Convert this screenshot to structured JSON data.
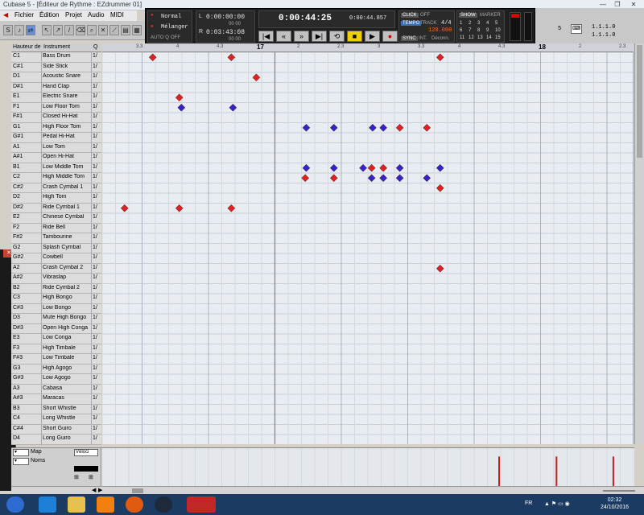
{
  "window": {
    "title": "Cubase 5 - [Éditeur de Rythme : EZdrummer 01]"
  },
  "menu": {
    "items": [
      "Fichier",
      "Édition",
      "Projet",
      "Audio",
      "MIDI"
    ]
  },
  "transport": {
    "mode1": "Normal",
    "mode2": "Mélanger",
    "auto_q": "AUTO Q",
    "auto_q_state": "OFF",
    "left_locator": "0:00:00:00",
    "right_locator": "0:03:43:08",
    "sub1": "00 00",
    "sub2": "00 00",
    "primary_time": "0:00:44:25",
    "secondary_time": "0:00:44.857",
    "click_label": "CLICK",
    "click_state": "OFF",
    "tempo_label": "TEMPO",
    "track_label": "TRACK",
    "signature": "4/4",
    "tempo_value": "120.000",
    "sync_label": "SYNC",
    "int_label": "INT.",
    "deconn_label": "Déconn.",
    "show_label": "SHOW",
    "marker_label": "MARKER",
    "marker_numbers": [
      "1",
      "2",
      "3",
      "4",
      "5",
      "6",
      "7",
      "8",
      "9",
      "10",
      "11",
      "12",
      "13",
      "14",
      "15"
    ]
  },
  "right_panel": {
    "v1": "1.1.1.0",
    "v2": "1.1.1.0",
    "v3": "5"
  },
  "list_header": {
    "pitch": "Hauteur de",
    "instrument": "Instrument",
    "q": "Q"
  },
  "instruments": [
    {
      "pitch": "C1",
      "name": "Bass Drum",
      "q": "1/"
    },
    {
      "pitch": "C#1",
      "name": "Side Stick",
      "q": "1/"
    },
    {
      "pitch": "D1",
      "name": "Acoustic Snare",
      "q": "1/"
    },
    {
      "pitch": "D#1",
      "name": "Hand Clap",
      "q": "1/"
    },
    {
      "pitch": "E1",
      "name": "Electric Snare",
      "q": "1/"
    },
    {
      "pitch": "F1",
      "name": "Low Floor Tom",
      "q": "1/"
    },
    {
      "pitch": "F#1",
      "name": "Closed Hi-Hat",
      "q": "1/"
    },
    {
      "pitch": "G1",
      "name": "High Floor Tom",
      "q": "1/"
    },
    {
      "pitch": "G#1",
      "name": "Pedal Hi-Hat",
      "q": "1/"
    },
    {
      "pitch": "A1",
      "name": "Low Tom",
      "q": "1/"
    },
    {
      "pitch": "A#1",
      "name": "Open Hi-Hat",
      "q": "1/"
    },
    {
      "pitch": "B1",
      "name": "Low Middle Tom",
      "q": "1/"
    },
    {
      "pitch": "C2",
      "name": "High Middle Tom",
      "q": "1/"
    },
    {
      "pitch": "C#2",
      "name": "Crash Cymbal 1",
      "q": "1/"
    },
    {
      "pitch": "D2",
      "name": "High Tom",
      "q": "1/"
    },
    {
      "pitch": "D#2",
      "name": "Ride Cymbal 1",
      "q": "1/"
    },
    {
      "pitch": "E2",
      "name": "Chinese Cymbal",
      "q": "1/"
    },
    {
      "pitch": "F2",
      "name": "Ride Bell",
      "q": "1/"
    },
    {
      "pitch": "F#2",
      "name": "Tambourine",
      "q": "1/"
    },
    {
      "pitch": "G2",
      "name": "Splash Cymbal",
      "q": "1/"
    },
    {
      "pitch": "G#2",
      "name": "Cowbell",
      "q": "1/"
    },
    {
      "pitch": "A2",
      "name": "Crash Cymbal 2",
      "q": "1/"
    },
    {
      "pitch": "A#2",
      "name": "Vibraslap",
      "q": "1/"
    },
    {
      "pitch": "B2",
      "name": "Ride Cymbal 2",
      "q": "1/"
    },
    {
      "pitch": "C3",
      "name": "High Bongo",
      "q": "1/"
    },
    {
      "pitch": "C#3",
      "name": "Low Bongo",
      "q": "1/"
    },
    {
      "pitch": "D3",
      "name": "Mute High Bongo",
      "q": "1/"
    },
    {
      "pitch": "D#3",
      "name": "Open High Conga",
      "q": "1/"
    },
    {
      "pitch": "E3",
      "name": "Low Conga",
      "q": "1/"
    },
    {
      "pitch": "F3",
      "name": "High Timbale",
      "q": "1/"
    },
    {
      "pitch": "F#3",
      "name": "Low Timbale",
      "q": "1/"
    },
    {
      "pitch": "G3",
      "name": "High Agogo",
      "q": "1/"
    },
    {
      "pitch": "G#3",
      "name": "Low Agogo",
      "q": "1/"
    },
    {
      "pitch": "A3",
      "name": "Cabasa",
      "q": "1/"
    },
    {
      "pitch": "A#3",
      "name": "Maracas",
      "q": "1/"
    },
    {
      "pitch": "B3",
      "name": "Short Whistle",
      "q": "1/"
    },
    {
      "pitch": "C4",
      "name": "Long Whistle",
      "q": "1/"
    },
    {
      "pitch": "C#4",
      "name": "Short Guiro",
      "q": "1/"
    },
    {
      "pitch": "D4",
      "name": "Long Guiro",
      "q": "1/"
    }
  ],
  "ruler": {
    "labels": [
      "3.3",
      "4",
      "4.3",
      "17",
      "2",
      "2.3",
      "3",
      "3.3",
      "4",
      "4.3",
      "18",
      "2",
      "2.3"
    ],
    "bar_labels": [
      "17",
      "18"
    ]
  },
  "notes_description": "drum hits: row index (from instrument list) and beat position (0..1 across visible range), color red or blue",
  "drum_hits": [
    {
      "row": 0,
      "pos": 0.095,
      "color": "red"
    },
    {
      "row": 0,
      "pos": 0.243,
      "color": "red"
    },
    {
      "row": 0,
      "pos": 0.636,
      "color": "red"
    },
    {
      "row": 2,
      "pos": 0.29,
      "color": "red"
    },
    {
      "row": 4,
      "pos": 0.145,
      "color": "red"
    },
    {
      "row": 5,
      "pos": 0.149,
      "color": "blue"
    },
    {
      "row": 5,
      "pos": 0.246,
      "color": "blue"
    },
    {
      "row": 7,
      "pos": 0.384,
      "color": "blue"
    },
    {
      "row": 7,
      "pos": 0.436,
      "color": "blue"
    },
    {
      "row": 7,
      "pos": 0.509,
      "color": "blue"
    },
    {
      "row": 7,
      "pos": 0.529,
      "color": "blue"
    },
    {
      "row": 7,
      "pos": 0.56,
      "color": "red"
    },
    {
      "row": 7,
      "pos": 0.611,
      "color": "red"
    },
    {
      "row": 11,
      "pos": 0.384,
      "color": "blue"
    },
    {
      "row": 11,
      "pos": 0.436,
      "color": "blue"
    },
    {
      "row": 11,
      "pos": 0.491,
      "color": "blue"
    },
    {
      "row": 11,
      "pos": 0.507,
      "color": "red"
    },
    {
      "row": 11,
      "pos": 0.529,
      "color": "red"
    },
    {
      "row": 11,
      "pos": 0.56,
      "color": "blue"
    },
    {
      "row": 11,
      "pos": 0.636,
      "color": "blue"
    },
    {
      "row": 12,
      "pos": 0.382,
      "color": "red"
    },
    {
      "row": 12,
      "pos": 0.436,
      "color": "red"
    },
    {
      "row": 12,
      "pos": 0.507,
      "color": "blue"
    },
    {
      "row": 12,
      "pos": 0.529,
      "color": "blue"
    },
    {
      "row": 12,
      "pos": 0.56,
      "color": "blue"
    },
    {
      "row": 12,
      "pos": 0.611,
      "color": "blue"
    },
    {
      "row": 13,
      "pos": 0.636,
      "color": "red"
    },
    {
      "row": 15,
      "pos": 0.042,
      "color": "red"
    },
    {
      "row": 15,
      "pos": 0.145,
      "color": "red"
    },
    {
      "row": 15,
      "pos": 0.243,
      "color": "red"
    },
    {
      "row": 21,
      "pos": 0.636,
      "color": "red"
    }
  ],
  "velocity_lane": {
    "map_label": "Map",
    "velocity_label": "Véloci",
    "names_label": "Noms",
    "bars": [
      0.78,
      0.78,
      0.78
    ],
    "bar_positions": [
      0.747,
      0.855,
      0.962
    ]
  },
  "colors": {
    "note_red": "#e22020",
    "note_blue": "#3a20c8",
    "grid_bg": "#e9edf2",
    "transport_bg": "#1e1e1e",
    "taskbar_bg": "#1b3b63"
  },
  "taskbar": {
    "lang": "FR",
    "time": "02:32",
    "date": "24/10/2016"
  }
}
